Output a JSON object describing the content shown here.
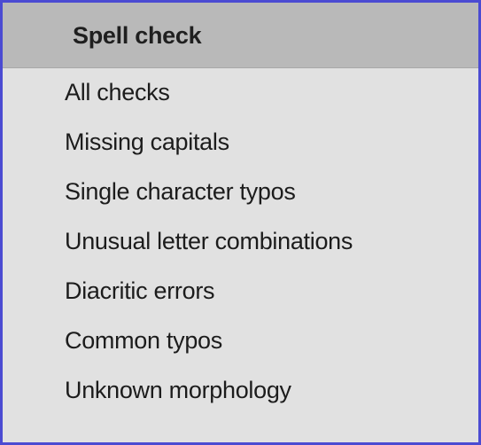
{
  "menu": {
    "header": "Spell check",
    "items": [
      {
        "label": "All checks"
      },
      {
        "label": "Missing capitals"
      },
      {
        "label": "Single character typos"
      },
      {
        "label": "Unusual letter combinations"
      },
      {
        "label": "Diacritic errors"
      },
      {
        "label": "Common typos"
      },
      {
        "label": "Unknown morphology"
      }
    ]
  },
  "colors": {
    "panel_background": "#e1e1e1",
    "header_background": "#b9b9b9",
    "border": "#4b4bd2",
    "text": "#1c1c1c"
  }
}
